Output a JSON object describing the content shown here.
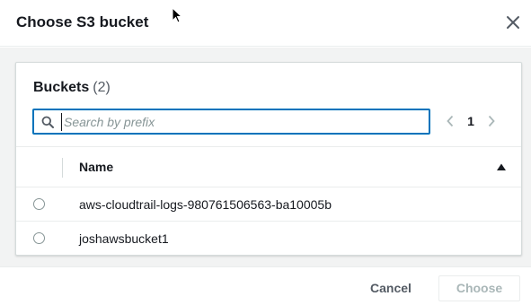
{
  "modal": {
    "title": "Choose S3 bucket"
  },
  "table": {
    "title": "Buckets",
    "count": "(2)",
    "search": {
      "placeholder": "Search by prefix",
      "value": ""
    },
    "pagination": {
      "current_page": "1"
    },
    "columns": [
      "Name"
    ],
    "sort": "ascending",
    "rows": [
      {
        "name": "aws-cloudtrail-logs-980761506563-ba10005b",
        "selected": false
      },
      {
        "name": "joshawsbucket1",
        "selected": false
      }
    ]
  },
  "footer": {
    "cancel_label": "Cancel",
    "choose_label": "Choose",
    "choose_disabled": true
  },
  "colors": {
    "accent": "#0073bb",
    "text": "#16191f",
    "muted": "#545b64",
    "disabled": "#aab7b8",
    "background": "#f2f3f3"
  },
  "icons": [
    "close-icon",
    "search-icon",
    "chevron-left-icon",
    "chevron-right-icon",
    "sort-ascending-icon",
    "mouse-cursor-icon"
  ]
}
